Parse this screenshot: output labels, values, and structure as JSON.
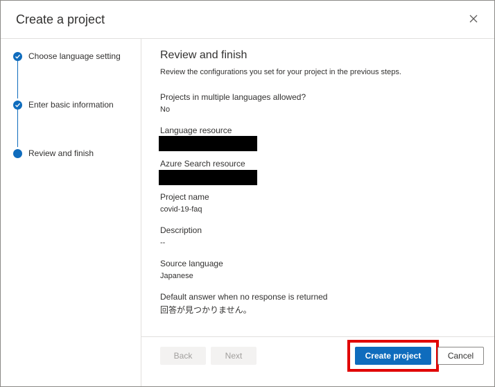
{
  "dialog": {
    "title": "Create a project",
    "close_icon": "close-icon"
  },
  "steps": [
    {
      "label": "Choose language setting",
      "state": "completed",
      "icon": "checkmark-icon"
    },
    {
      "label": "Enter basic information",
      "state": "completed",
      "icon": "checkmark-icon"
    },
    {
      "label": "Review and finish",
      "state": "current",
      "icon": "filled-circle-icon"
    }
  ],
  "review": {
    "heading": "Review and finish",
    "subtitle": "Review the configurations you set for your project in the previous steps.",
    "fields": {
      "multilang": {
        "label": "Projects in multiple languages allowed?",
        "value": "No"
      },
      "language_resource": {
        "label": "Language resource",
        "value": ""
      },
      "search_resource": {
        "label": "Azure Search resource",
        "value": ""
      },
      "project_name": {
        "label": "Project name",
        "value": "covid-19-faq"
      },
      "description": {
        "label": "Description",
        "value": "--"
      },
      "source_language": {
        "label": "Source language",
        "value": "Japanese"
      },
      "default_answer": {
        "label": "Default answer when no response is returned",
        "value": "回答が見つかりません。"
      }
    }
  },
  "footer": {
    "back_label": "Back",
    "next_label": "Next",
    "create_label": "Create project",
    "cancel_label": "Cancel"
  },
  "colors": {
    "accent": "#0f6cbd",
    "highlight": "#e00000",
    "redaction": "#000000"
  }
}
